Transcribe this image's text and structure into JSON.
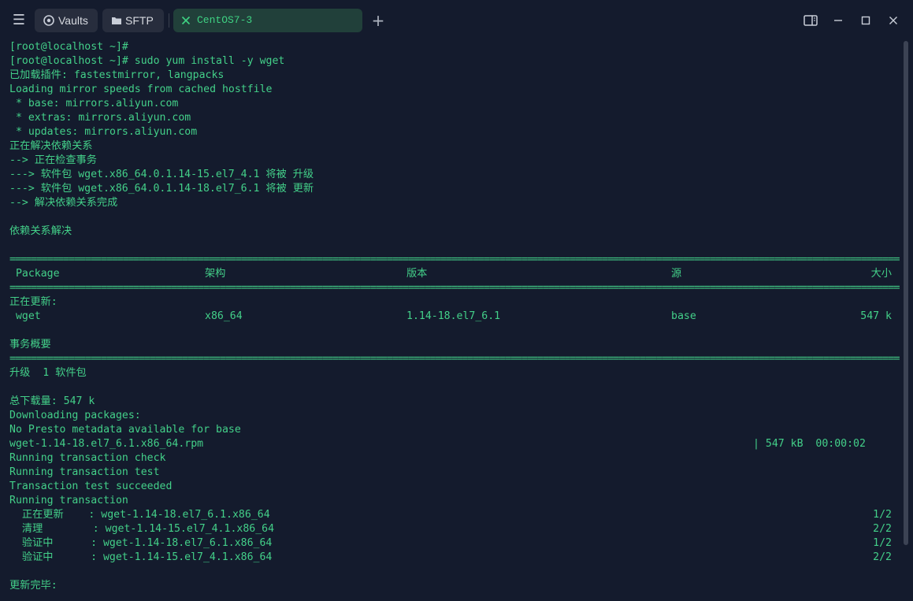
{
  "titlebar": {
    "tabs": [
      {
        "label": "Vaults",
        "icon": "vault-icon"
      },
      {
        "label": "SFTP",
        "icon": "folder-icon"
      },
      {
        "label": "CentOS7-3",
        "icon": "close-icon",
        "active": true
      }
    ],
    "colors": {
      "active_tab_bg": "#21403a",
      "accent": "#3fd283",
      "tab_bg": "#272d3d"
    }
  },
  "terminal": {
    "text_color": "#43d089",
    "background": "#141b2d",
    "lines": [
      "[root@localhost ~]#",
      "[root@localhost ~]# sudo yum install -y wget",
      "已加载插件: fastestmirror, langpacks",
      "Loading mirror speeds from cached hostfile",
      " * base: mirrors.aliyun.com",
      " * extras: mirrors.aliyun.com",
      " * updates: mirrors.aliyun.com",
      "正在解决依赖关系",
      "--> 正在检查事务",
      "---> 软件包 wget.x86_64.0.1.14-15.el7_4.1 将被 升级",
      "---> 软件包 wget.x86_64.0.1.14-18.el7_6.1 将被 更新",
      "--> 解决依赖关系完成",
      "",
      "依赖关系解决",
      ""
    ],
    "rule": "==================================================================================================================================================================================",
    "table_header": {
      "package": " Package",
      "arch": "架构",
      "version": "版本",
      "repo": "源",
      "size": "大小"
    },
    "section_updating": "正在更新:",
    "table_row": {
      "package": " wget",
      "arch": "x86_64",
      "version": "1.14-18.el7_6.1",
      "repo": "base",
      "size": "547 k"
    },
    "summary_title": "事务概要",
    "upgrade_line": "升级  1 软件包",
    "total_download": "总下载量: 547 k",
    "downloading": "Downloading packages:",
    "no_presto": "No Presto metadata available for base",
    "rpm_file": "wget-1.14-18.el7_6.1.x86_64.rpm",
    "rpm_progress": "| 547 kB  00:00:02",
    "txn_check": "Running transaction check",
    "txn_test": "Running transaction test",
    "txn_test_ok": "Transaction test succeeded",
    "txn_run": "Running transaction",
    "steps": [
      {
        "action": "  正在更新    : wget-1.14-18.el7_6.1.x86_64",
        "count": "1/2"
      },
      {
        "action": "  清理        : wget-1.14-15.el7_4.1.x86_64",
        "count": "2/2"
      },
      {
        "action": "  验证中      : wget-1.14-18.el7_6.1.x86_64",
        "count": "1/2"
      },
      {
        "action": "  验证中      : wget-1.14-15.el7_4.1.x86_64",
        "count": "2/2"
      }
    ],
    "complete": "更新完毕:"
  }
}
